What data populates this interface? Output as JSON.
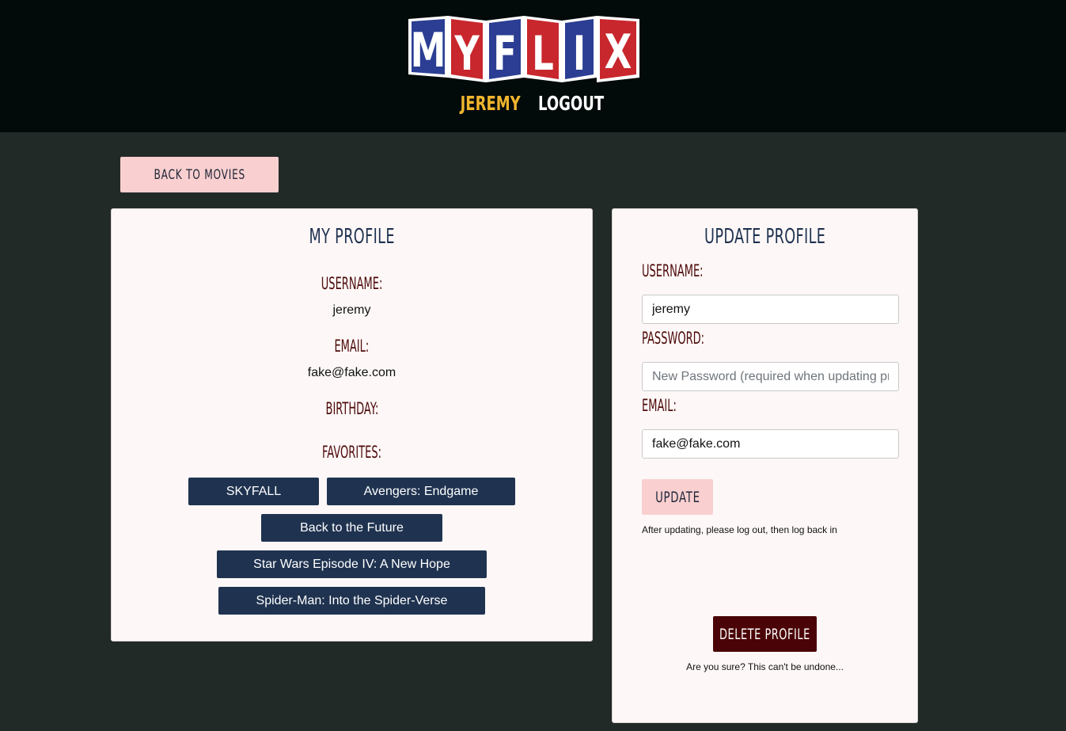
{
  "brand": {
    "logo_letters": [
      "M",
      "Y",
      "F",
      "L",
      "I",
      "X"
    ],
    "colors": {
      "blue": "#2b3e93",
      "red": "#c8272d",
      "white": "#ffffff"
    }
  },
  "nav": {
    "username": "JEREMY",
    "logout": "LOGOUT"
  },
  "back_button": "BACK TO MOVIES",
  "profile": {
    "title": "MY PROFILE",
    "username_label": "USERNAME:",
    "username_value": "jeremy",
    "email_label": "EMAIL:",
    "email_value": "fake@fake.com",
    "birthday_label": "BIRTHDAY:",
    "favorites_label": "FAVORITES:",
    "favorites": [
      "SKYFALL",
      "Avengers: Endgame",
      "Back to the Future",
      "Star Wars Episode IV: A New Hope",
      "Spider-Man: Into the Spider-Verse"
    ]
  },
  "update": {
    "title": "UPDATE PROFILE",
    "username_label": "USERNAME:",
    "username_value": "jeremy",
    "password_label": "PASSWORD:",
    "password_placeholder": "New Password (required when updating profile)",
    "email_label": "EMAIL:",
    "email_value": "fake@fake.com",
    "update_button": "UPDATE",
    "update_note": "After updating, please log out, then log back in",
    "delete_button": "DELETE PROFILE",
    "delete_note": "Are you sure? This can't be undone..."
  },
  "theme": {
    "page_bg": "#222a28",
    "header_bg": "#030a0a",
    "card_bg": "#fdf8f7",
    "accent_pink": "#f9cfcf",
    "navy": "#1f3350",
    "maroon": "#4d0a0a",
    "gold": "#f0b52d"
  }
}
